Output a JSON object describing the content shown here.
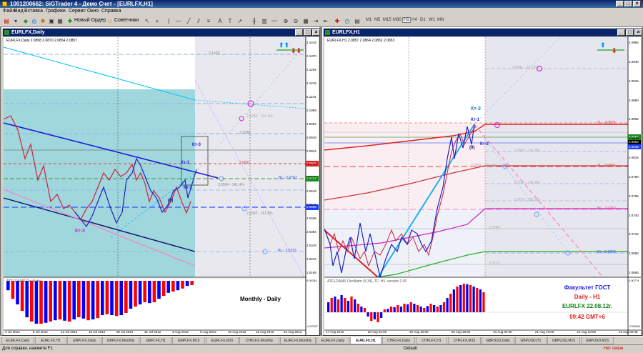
{
  "window": {
    "title": "1001200662: SiGTrader 4 - Демо Счет - [EURLFX,H1]"
  },
  "menu": [
    "Файл",
    "Вид",
    "Вставка",
    "Графики",
    "Сервис",
    "Окно",
    "Справка"
  ],
  "toolbar": {
    "new_order": "Новый Ордер",
    "advisors": "Советники",
    "timeframes": [
      "M1",
      "M5",
      "M15",
      "M30",
      "H1",
      "H4",
      "D1",
      "W1",
      "MN"
    ],
    "active_timeframe": "H1"
  },
  "left_chart": {
    "window_title": "EURLFX,Daily",
    "info": "EURLFX,Daily  2.0858 2.0870 2.0854 2.0857",
    "labels": {
      "kt1": "Кт-1",
      "kt2": "Кт-2",
      "kt3a": "Кт-3",
      "kt3b": "Кт-3",
      "nine": "(9)",
      "caption": "Monthly - Daily"
    },
    "price_axis": [
      "2.1444",
      "2.1370",
      "2.1294",
      "2.1219",
      "2.1144",
      "2.1069",
      "2.0994",
      "2.0919",
      "2.0844",
      "2.0769",
      "2.0694",
      "2.0619",
      "2.0544",
      "2.0469",
      "2.0394",
      "2.0319",
      "2.0244",
      "2.0169"
    ],
    "price_tags": {
      "red": "2.0842",
      "green": "2.0757",
      "blue": "2.0686"
    },
    "line_labels": {
      "l1": "2.1425",
      "l2": "2.0811",
      "l3": "2.0594 - 141.4%",
      "l4": "2.1085",
      "l5": "BL - 2.0747",
      "l6": "2.0693 - 161.8%",
      "l7": "2.1283 - 141.4%",
      "l8": "BL - 2.0333"
    },
    "osc_axis": [
      "0.00334",
      "-0.07337"
    ],
    "osc_title": "ATEI,DAMS Oscillator",
    "osc_values": [
      -0.22,
      -0.42,
      -0.55,
      -0.7,
      -0.85,
      -0.95,
      -1.0,
      -1.0,
      -0.98,
      -0.95,
      -0.92,
      -0.9,
      -0.93,
      -0.95,
      -0.9,
      -0.85,
      -0.88,
      -0.92,
      -0.9,
      -0.87,
      -0.8,
      -0.78,
      -0.8,
      -0.82,
      -0.8,
      -0.75,
      -0.65,
      -0.6,
      -0.55,
      -0.5,
      -0.52,
      -0.5,
      -0.42,
      -0.35,
      -0.28,
      -0.25,
      -0.22,
      -0.18,
      -0.12,
      -0.1
    ],
    "time_axis": [
      "3 Jul 2012",
      "9 Jul 2012",
      "13 Jul 2012",
      "19 Jul 2012",
      "25 Jul 2012",
      "31 Jul 2012",
      "3 Aug 2012",
      "6 Aug 2012",
      "10 Aug 2012",
      "16 Aug 2012",
      "22 Aug 2012"
    ]
  },
  "right_chart": {
    "window_title": "EURLFX,H1",
    "info": "EURLFX,H1  2.0857 2.0864 2.0852 2.0853",
    "labels": {
      "kt1": "Кт-1",
      "kt2": "Кт-2",
      "kt3": "Кт-3",
      "nine": "(9)"
    },
    "price_axis": [
      "2.0965",
      "2.0940",
      "2.0915",
      "2.0890",
      "2.0865",
      "2.0840",
      "2.0815",
      "2.0790",
      "2.0765",
      "2.0740",
      "2.0715",
      "2.0690",
      "2.0665"
    ],
    "price_tags": {
      "green": "2.0857",
      "black": "2.0853",
      "blue": "2.0848"
    },
    "line_labels": {
      "l1": "2.0941 - 161.8%",
      "l2": "TL - 2.0876",
      "l3": "2.0845 - 161.8%",
      "l4": "2.0826 - 161.8%",
      "l5": "TL - 2.0824",
      "l6": "2.0795 - 161.8%",
      "l7": "2.0776 - 161.8%",
      "l8": "2.0749",
      "l9": "BL - 2.0753",
      "l10": "2.0713",
      "l11": "BL - 2.0693"
    },
    "osc_axis": [
      "0.00774",
      "-0.00546"
    ],
    "osc_title": "ATEI,DAMS Oscillator (5,34), TF: H1, version 1.00",
    "osc_values": [
      0.35,
      0.5,
      0.55,
      0.45,
      0.6,
      0.5,
      0.4,
      0.55,
      0.45,
      0.3,
      0.2,
      0.15,
      -0.15,
      -0.3,
      -0.25,
      -0.35,
      -0.2,
      0.1,
      0.12,
      0.2,
      0.18,
      0.25,
      0.2,
      0.3,
      0.28,
      0.35,
      0.3,
      0.25,
      0.2,
      0.15,
      0.22,
      0.3,
      0.25,
      0.2,
      0.25,
      0.35,
      0.5,
      0.65,
      0.8,
      0.9,
      0.95,
      1.0,
      0.98,
      0.95,
      0.9,
      0.85,
      0.8,
      0.7
    ],
    "time_axis": [
      "17 Aug 2012",
      "20 Aug 02:00",
      "20 Aug 10:00",
      "20 Aug 18:00",
      "21 Aug 02:00",
      "21 Aug 10:00",
      "21 Aug 18:00",
      "22 Aug 02:00"
    ],
    "overlay": {
      "line1": "Факультет ГОСТ",
      "line2": "Daily - H1",
      "line3": "EURLFX 22.08.12г.",
      "line4": "09:42 GMT+6"
    }
  },
  "tabs": [
    "EURLFX,Daily",
    "EURLFX,H1",
    "GBPLFX,Daily",
    "GBPLFX,Monthly",
    "GBPLFX,H1",
    "GBPLFX,M15",
    "EURLFX,M15",
    "CHFLFX,Monthly",
    "EURLFX,Monthly",
    "EURLFX,Daily",
    "EURLFX,H1",
    "CHFLFX,Daily",
    "CHFLFX,H1",
    "CHFLFX,M15",
    "GBPUSD,Daily",
    "GBPUSD,H1",
    "GBPUSD,M15",
    "GBPUSD,M15"
  ],
  "active_tab": "EURLFX,H1",
  "status": {
    "help": "Для справки, нажмите F1",
    "profile": "Default",
    "connection": "Нет связи"
  },
  "colors": {
    "title_bg": "#0a246a",
    "bull": "#0000ff",
    "bear": "#ff0000",
    "cyan": "#00bfff",
    "magenta": "#ff00ff",
    "teal_zone": "#9fd7dc"
  }
}
